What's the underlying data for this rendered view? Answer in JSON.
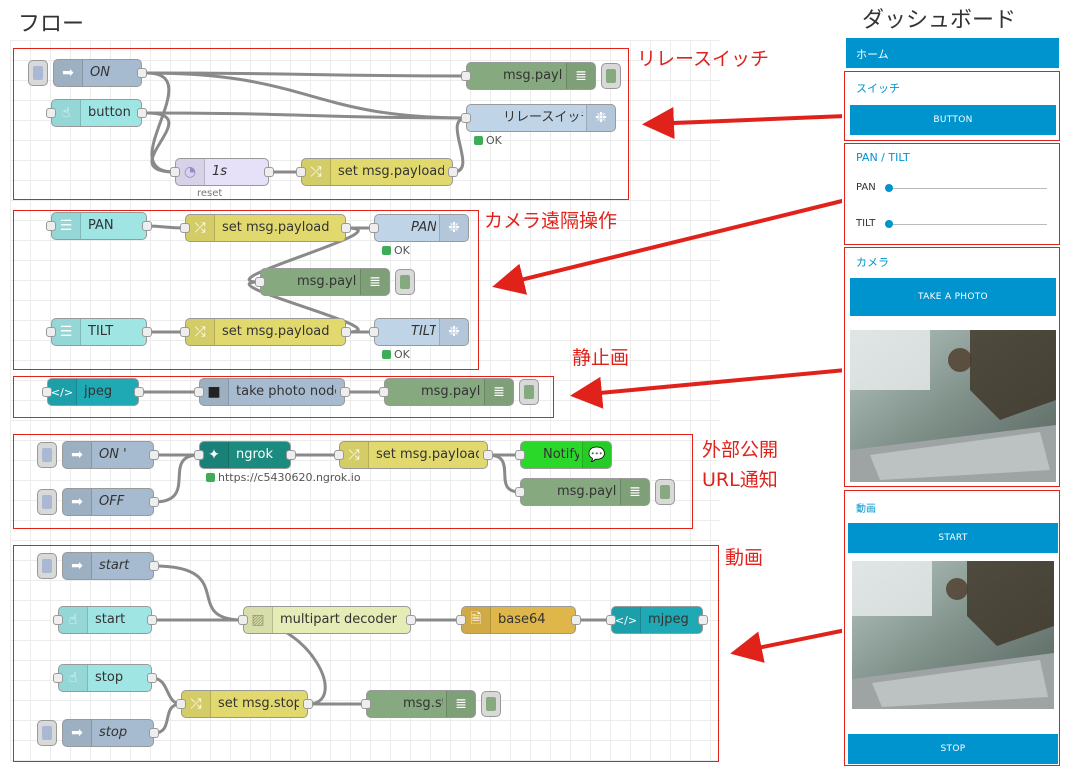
{
  "headings": {
    "flow": "フロー",
    "dashboard": "ダッシュボード"
  },
  "groups": {
    "relay": "リレースイッチ",
    "camera": "カメラ遠隔操作",
    "still": "静止画",
    "url_line1": "外部公開",
    "url_line2": "URL通知",
    "video": "動画"
  },
  "nodes": {
    "on": "ON",
    "button": "button",
    "msg_payload": "msg.payload",
    "relay_switch": "リレースイッチ",
    "delay": "1s",
    "set_payload": "set msg.payload",
    "pan": "PAN",
    "tilt": "TILT",
    "jpeg": "jpeg",
    "take_photo": "take photo node",
    "on2": "ON '",
    "off": "OFF",
    "ngrok": "ngrok",
    "notify": "Notify",
    "start": "start",
    "multipart": "multipart decoder",
    "base64": "base64",
    "mjpeg": "mjpeg",
    "stop": "stop",
    "set_stop": "set msg.stop",
    "msg_stop": "msg.stop"
  },
  "status": {
    "ok": "OK",
    "reset": "reset",
    "ngrok_url": "https://c5430620.ngrok.io"
  },
  "dashboard": {
    "home": "ホーム",
    "switch_title": "スイッチ",
    "button_label": "BUTTON",
    "pantilt_title": "PAN / TILT",
    "pan_label": "PAN",
    "tilt_label": "TILT",
    "pan_value": 0,
    "tilt_value": 0,
    "camera_title": "カメラ",
    "take_photo_label": "TAKE A PHOTO",
    "video_title": "動画",
    "start_label": "START",
    "stop_label": "STOP"
  },
  "colors": {
    "accent": "#0094ce",
    "annotation": "#e0221b",
    "inject": "#a6bbcf",
    "ui_button": "#9ee5e4",
    "debug": "#87a980",
    "rpi": "#c0d4e8",
    "delay": "#e6e0f8",
    "change": "#e2d96e",
    "template": "#1fa9b5",
    "ngrok": "#1b8a7f",
    "notify": "#2ad82a",
    "multipart": "#e6ecb6",
    "base64": "#deb64a",
    "camera": "#a6bbcf"
  }
}
